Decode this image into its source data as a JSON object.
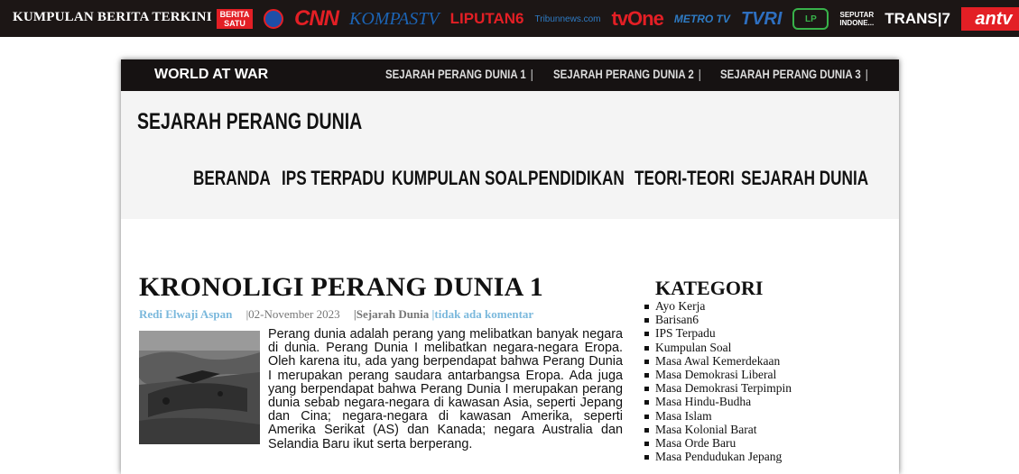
{
  "newsbar": {
    "title": "KUMPULAN BERITA TERKINI",
    "logos": {
      "beritasatu": [
        "BERITA",
        "SATU"
      ],
      "cnn": "CNN",
      "kompas": "KOMPASTV",
      "liputan": "LIPUTAN6",
      "tribun": "Tribunnews.com",
      "tvone": "tvOne",
      "metro": "METRO TV",
      "tvri": "TVRI",
      "lombok": "LP",
      "seputar": [
        "SEPUTAR",
        "INDONE..."
      ],
      "trans7": "TRANS|7",
      "antv": "antv"
    }
  },
  "worldbar": {
    "title": "WORLD AT WAR",
    "links": [
      "SEJARAH PERANG DUNIA 1",
      "SEJARAH PERANG DUNIA 2",
      "SEJARAH PERANG DUNIA 3"
    ]
  },
  "header": {
    "site_title": "SEJARAH PERANG DUNIA",
    "nav": [
      "BERANDA",
      "IPS TERPADU",
      "KUMPULAN SOAL",
      "PENDIDIKAN",
      "TEORI-TEORI",
      "SEJARAH DUNIA"
    ]
  },
  "article": {
    "title": "KRONOLIGI PERANG DUNIA 1",
    "author": "Redi Elwaji Aspan",
    "date": "|02-November 2023",
    "category": "|Sejarah Dunia",
    "comments": "|tidak ada komentar",
    "body": "Perang dunia adalah perang yang melibatkan banyak negara di dunia. Perang Dunia I melibatkan negara-negara Eropa. Oleh karena itu, ada yang berpendapat bahwa Perang Dunia I merupakan perang saudara antarbangsa Eropa. Ada juga yang berpendapat bahwa Perang Dunia I merupakan perang dunia sebab negara-negara di kawasan Asia, seperti Jepang dan Cina; negara-negara di kawasan Amerika, seperti Amerika Serikat (AS) dan Kanada; negara Australia dan Selandia Baru ikut serta berperang."
  },
  "sidebar": {
    "title": "KATEGORI",
    "items": [
      "Ayo Kerja",
      "Barisan6",
      "IPS Terpadu",
      "Kumpulan Soal",
      "Masa Awal Kemerdekaan",
      "Masa Demokrasi Liberal",
      "Masa Demokrasi Terpimpin",
      "Masa Hindu-Budha",
      "Masa Islam",
      "Masa Kolonial Barat",
      "Masa Orde Baru",
      "Masa Pendudukan Jepang"
    ]
  }
}
